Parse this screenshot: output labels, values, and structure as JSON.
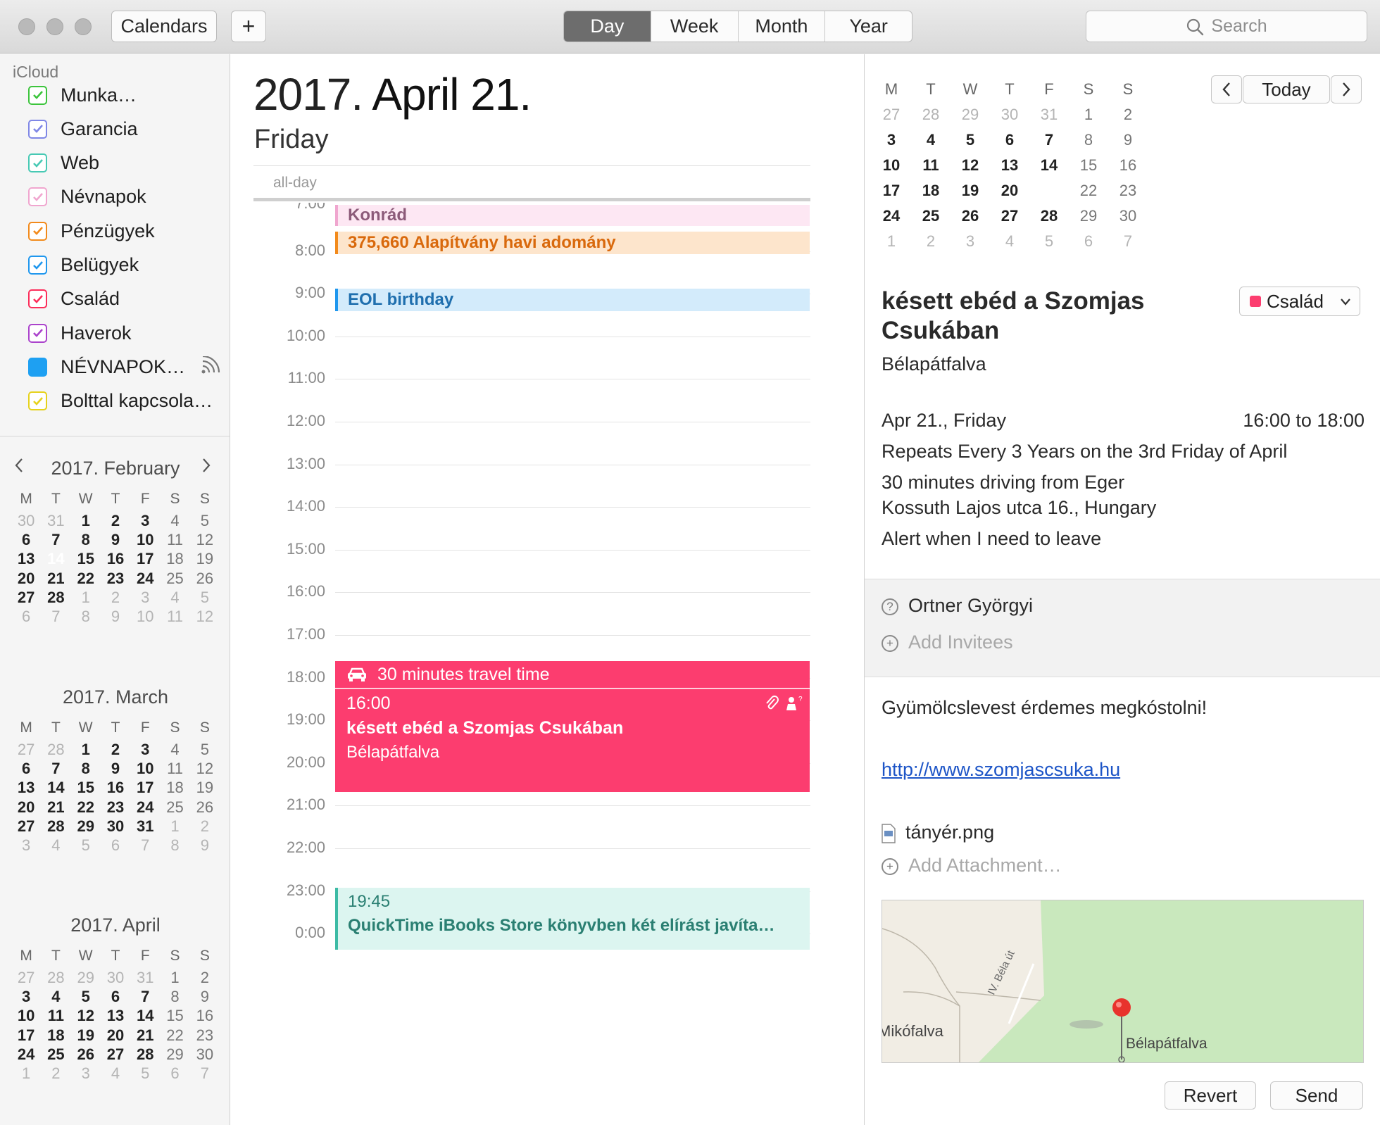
{
  "toolbar": {
    "calendars_label": "Calendars",
    "add_label": "+",
    "views": [
      "Day",
      "Week",
      "Month",
      "Year"
    ],
    "active_view": "Day",
    "search_placeholder": "Search"
  },
  "sidebar": {
    "account": "iCloud",
    "calendars": [
      {
        "name": "Munka…",
        "color": "#3cc43c",
        "checked": true
      },
      {
        "name": "Garancia",
        "color": "#7f87e6",
        "checked": true
      },
      {
        "name": "Web",
        "color": "#47c9b4",
        "checked": true
      },
      {
        "name": "Névnapok",
        "color": "#f0a6cf",
        "checked": true
      },
      {
        "name": "Pénzügyek",
        "color": "#f28a1b",
        "checked": true
      },
      {
        "name": "Belügyek",
        "color": "#1f97ee",
        "checked": true
      },
      {
        "name": "Család",
        "color": "#fc2d5a",
        "checked": true
      },
      {
        "name": "Haverok",
        "color": "#ab43cc",
        "checked": true
      },
      {
        "name": "NÉVNAPOK…",
        "color": "#1ea0f2",
        "checked": false,
        "subscribed": true
      },
      {
        "name": "Bolttal kapcsola…",
        "color": "#e6d21c",
        "checked": true
      }
    ],
    "mini_calendars": [
      {
        "title": "2017. February",
        "weekdays": [
          "M",
          "T",
          "W",
          "T",
          "F",
          "S",
          "S"
        ],
        "weeks": [
          [
            "30",
            "31",
            "1",
            "2",
            "3",
            "4",
            "5"
          ],
          [
            "6",
            "7",
            "8",
            "9",
            "10",
            "11",
            "12"
          ],
          [
            "13",
            "14",
            "15",
            "16",
            "17",
            "18",
            "19"
          ],
          [
            "20",
            "21",
            "22",
            "23",
            "24",
            "25",
            "26"
          ],
          [
            "27",
            "28",
            "1",
            "2",
            "3",
            "4",
            "5"
          ],
          [
            "6",
            "7",
            "8",
            "9",
            "10",
            "11",
            "12"
          ]
        ],
        "today": "14"
      },
      {
        "title": "2017. March",
        "weekdays": [
          "M",
          "T",
          "W",
          "T",
          "F",
          "S",
          "S"
        ],
        "weeks": [
          [
            "27",
            "28",
            "1",
            "2",
            "3",
            "4",
            "5"
          ],
          [
            "6",
            "7",
            "8",
            "9",
            "10",
            "11",
            "12"
          ],
          [
            "13",
            "14",
            "15",
            "16",
            "17",
            "18",
            "19"
          ],
          [
            "20",
            "21",
            "22",
            "23",
            "24",
            "25",
            "26"
          ],
          [
            "27",
            "28",
            "29",
            "30",
            "31",
            "1",
            "2"
          ],
          [
            "3",
            "4",
            "5",
            "6",
            "7",
            "8",
            "9"
          ]
        ]
      },
      {
        "title": "2017. April",
        "weekdays": [
          "M",
          "T",
          "W",
          "T",
          "F",
          "S",
          "S"
        ],
        "weeks": [
          [
            "27",
            "28",
            "29",
            "30",
            "31",
            "1",
            "2"
          ],
          [
            "3",
            "4",
            "5",
            "6",
            "7",
            "8",
            "9"
          ],
          [
            "10",
            "11",
            "12",
            "13",
            "14",
            "15",
            "16"
          ],
          [
            "17",
            "18",
            "19",
            "20",
            "21",
            "22",
            "23"
          ],
          [
            "24",
            "25",
            "26",
            "27",
            "28",
            "29",
            "30"
          ],
          [
            "1",
            "2",
            "3",
            "4",
            "5",
            "6",
            "7"
          ]
        ]
      }
    ]
  },
  "day_view": {
    "year": "2017.",
    "date": "April 21.",
    "weekday": "Friday",
    "allday_label": "all-day",
    "hours": [
      "7:00",
      "8:00",
      "9:00",
      "10:00",
      "11:00",
      "12:00",
      "13:00",
      "14:00",
      "15:00",
      "16:00",
      "17:00",
      "18:00",
      "19:00",
      "20:00",
      "21:00",
      "22:00",
      "23:00",
      "0:00"
    ],
    "events": {
      "konrad": "Konrád",
      "adomany": "375,660 Alapítvány havi adomány",
      "eol": "EOL birthday",
      "travel": "30 minutes travel time",
      "main_time": "16:00",
      "main_title": "késett ebéd a Szomjas Csukában",
      "main_location": "Bélapátfalva",
      "qt_time": "19:45",
      "qt_title": "QuickTime iBooks Store könyvben két elírást javíta…"
    }
  },
  "inspector": {
    "mini": {
      "weekdays": [
        "M",
        "T",
        "W",
        "T",
        "F",
        "S",
        "S"
      ],
      "weeks": [
        [
          "27",
          "28",
          "29",
          "30",
          "31",
          "1",
          "2"
        ],
        [
          "3",
          "4",
          "5",
          "6",
          "7",
          "8",
          "9"
        ],
        [
          "10",
          "11",
          "12",
          "13",
          "14",
          "15",
          "16"
        ],
        [
          "17",
          "18",
          "19",
          "20",
          "21",
          "22",
          "23"
        ],
        [
          "24",
          "25",
          "26",
          "27",
          "28",
          "29",
          "30"
        ],
        [
          "1",
          "2",
          "3",
          "4",
          "5",
          "6",
          "7"
        ]
      ],
      "selected": "21",
      "today_label": "Today"
    },
    "title": "késett ebéd a Szomjas Csukában",
    "location": "Bélapátfalva",
    "calendar": "Család",
    "date": "Apr 21., Friday",
    "time": "16:00 to 18:00",
    "repeat": "Repeats Every 3 Years on the 3rd Friday of April",
    "travel_line1": "30 minutes driving from Eger",
    "travel_line2": "Kossuth Lajos utca 16., Hungary",
    "alert": "Alert when I need to leave",
    "invitee": "Ortner Györgyi",
    "add_invitees": "Add Invitees",
    "note": "Gyümölcslevest érdemes megkóstolni!",
    "url": "http://www.szomjascsuka.hu",
    "attachment": "tányér.png",
    "add_attachment": "Add Attachment…",
    "map": {
      "label_left": "Mikófalva",
      "label_road": "IV. Béla út",
      "label_pin": "Bélapátfalva"
    },
    "revert_label": "Revert",
    "send_label": "Send"
  }
}
